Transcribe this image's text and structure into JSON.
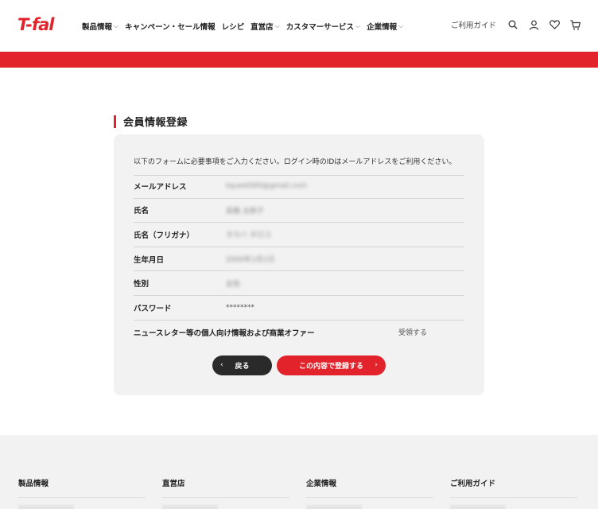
{
  "header": {
    "logo_text": "T-fal",
    "nav": [
      {
        "label": "製品情報",
        "has_dropdown": true
      },
      {
        "label": "キャンペーン・セール情報",
        "has_dropdown": false
      },
      {
        "label": "レシピ",
        "has_dropdown": false
      },
      {
        "label": "直営店",
        "has_dropdown": true
      },
      {
        "label": "カスタマーサービス",
        "has_dropdown": true
      },
      {
        "label": "企業情報",
        "has_dropdown": true
      }
    ],
    "guide_label": "ご利用ガイド",
    "icons": [
      "search-icon",
      "user-icon",
      "heart-icon",
      "cart-icon"
    ]
  },
  "colors": {
    "accent": "#e3232b",
    "dark_button": "#2a2a2a",
    "card_bg": "#f2f2f2"
  },
  "main": {
    "title": "会員情報登録",
    "intro": "以下のフォームに必要事項をご入力ください。ログイン時のIDはメールアドレスをご利用ください。",
    "rows": [
      {
        "label": "メールアドレス",
        "value": "tquest000@gmail.com"
      },
      {
        "label": "氏名",
        "value": "高橋 太郎子"
      },
      {
        "label": "氏名（フリガナ）",
        "value": "タカハ タロコ"
      },
      {
        "label": "生年月日",
        "value": "2000年1月1日"
      },
      {
        "label": "性別",
        "value": "女性"
      },
      {
        "label": "パスワード",
        "value": "********"
      },
      {
        "label": "ニュースレター等の個人向け情報および商業オファー",
        "value": "受領する"
      }
    ],
    "back_label": "戻る",
    "submit_label": "この内容で登録する"
  },
  "footer": {
    "columns": [
      {
        "title": "製品情報"
      },
      {
        "title": "直営店"
      },
      {
        "title": "企業情報"
      },
      {
        "title": "ご利用ガイド"
      }
    ]
  }
}
